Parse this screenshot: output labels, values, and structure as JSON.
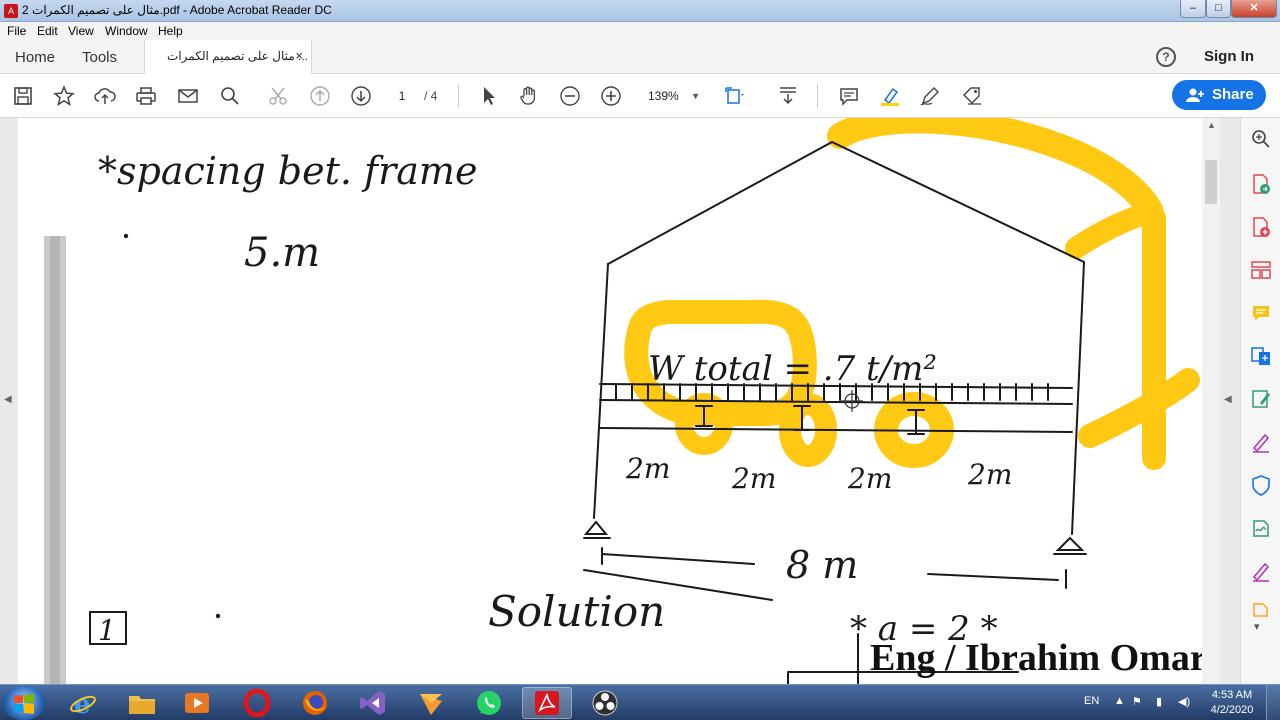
{
  "window": {
    "title": "مثال على تصميم الكمرات 2.pdf - Adobe Acrobat Reader DC",
    "controls": {
      "minimize": "–",
      "maximize": "□",
      "close": "✕"
    }
  },
  "menu": [
    "File",
    "Edit",
    "View",
    "Window",
    "Help"
  ],
  "tabs": {
    "home": "Home",
    "tools": "Tools",
    "document": "مثال على تصميم الكمرات ...",
    "close": "×"
  },
  "header": {
    "help": "?",
    "sign_in": "Sign In"
  },
  "toolbar": {
    "page_current": "1",
    "page_total": "/ 4",
    "zoom": "139%",
    "share_label": "Share",
    "icons": [
      "save-icon",
      "star-icon",
      "upload-icon",
      "print-icon",
      "email-icon",
      "search-icon",
      "scissors-icon",
      "page-up-icon",
      "page-down-icon",
      "select-icon",
      "hand-icon",
      "zoom-out-icon",
      "zoom-in-icon",
      "fit-page-icon",
      "scroll-mode-icon",
      "comment-icon",
      "highlight-icon",
      "draw-icon",
      "fill-sign-icon"
    ]
  },
  "document": {
    "handwriting": {
      "spacing_label": "*spacing bet. frame",
      "spacing_value": "5.m",
      "load": "W total = .7 t/m²",
      "span_1": "2m",
      "span_2": "2m",
      "span_3": "2m",
      "span_4": "2m",
      "total_span": "8 m",
      "solution": "Solution",
      "a_value": "* a = 2 *",
      "step": "1"
    },
    "watermark": "Eng / Ibrahim Omar",
    "colors": {
      "highlight": "#ffc400",
      "ink": "#1a1a1a"
    }
  },
  "right_pane": {
    "icons": [
      "zoom-icon",
      "export-pdf-icon",
      "create-pdf-icon",
      "organize-pages-icon",
      "comment-icon",
      "combine-files-icon",
      "edit-pdf-icon",
      "fill-sign-icon",
      "protect-icon",
      "send-for-signature-icon",
      "more-tools-icon",
      "scroll-down-icon"
    ],
    "more": "▾"
  },
  "taskbar": {
    "apps": [
      "internet-explorer-icon",
      "file-explorer-icon",
      "media-player-icon",
      "opera-icon",
      "firefox-icon",
      "visual-studio-icon",
      "sublime-icon",
      "whatsapp-icon",
      "acrobat-icon",
      "obs-icon"
    ],
    "language": "EN",
    "time": "4:53 AM",
    "date": "4/2/2020"
  }
}
